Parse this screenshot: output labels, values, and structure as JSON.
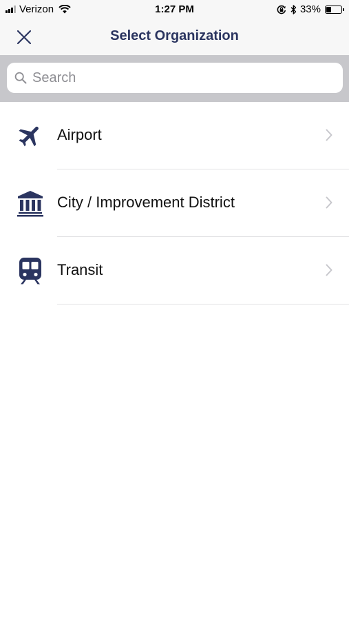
{
  "status_bar": {
    "carrier": "Verizon",
    "time": "1:27 PM",
    "battery_percent": "33%",
    "battery_level": 0.33,
    "icons": [
      "signal-bars-icon",
      "wifi-icon",
      "orientation-lock-icon",
      "bluetooth-icon",
      "battery-icon"
    ]
  },
  "header": {
    "title": "Select Organization",
    "close_icon": "close-icon"
  },
  "search": {
    "placeholder": "Search",
    "value": ""
  },
  "organizations": [
    {
      "label": "Airport",
      "icon": "airplane-icon"
    },
    {
      "label": "City / Improvement District",
      "icon": "government-building-icon"
    },
    {
      "label": "Transit",
      "icon": "train-icon"
    }
  ],
  "colors": {
    "brand": "#2b3560",
    "nav_background": "#f7f7f7",
    "search_band": "#c7c7cb",
    "chevron": "#c7c7cc"
  }
}
